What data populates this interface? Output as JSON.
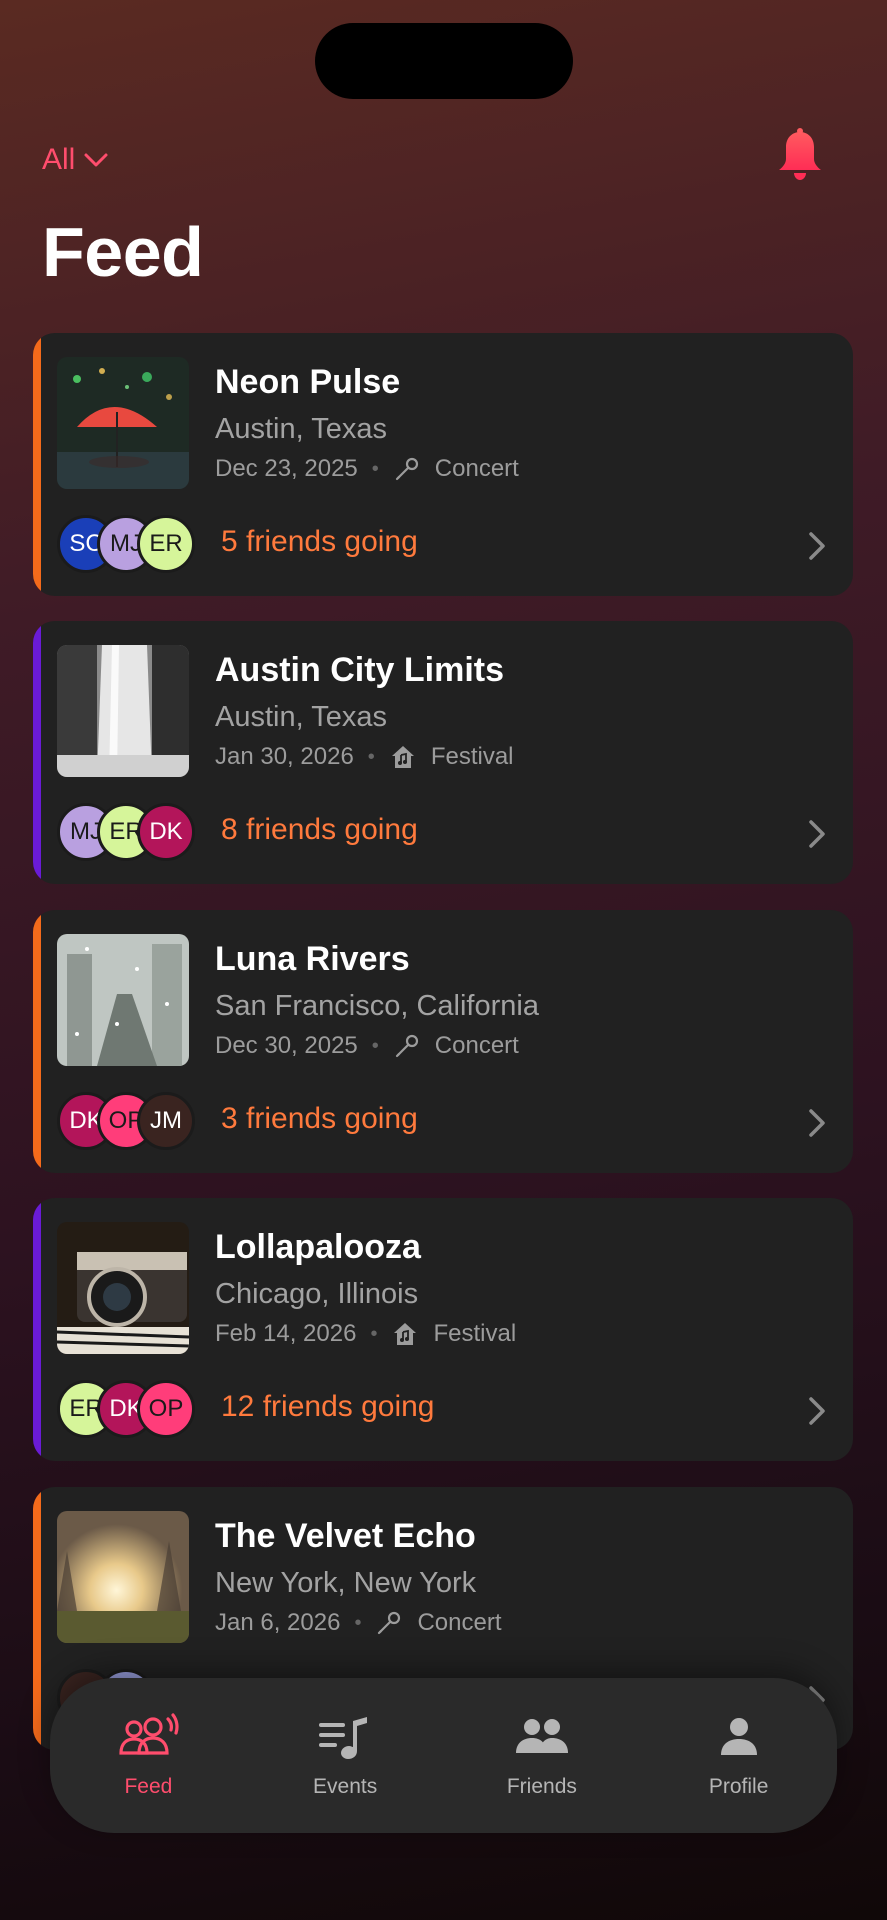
{
  "header": {
    "filter_label": "All",
    "title": "Feed"
  },
  "colors": {
    "accent_pink": "#ff4d6d",
    "accent_orange": "#ff7a3d",
    "concert_accent": "#f46a1b",
    "festival_accent": "#6a1bd6"
  },
  "events": [
    {
      "title": "Neon Pulse",
      "location": "Austin, Texas",
      "date": "Dec 23, 2025",
      "type": "Concert",
      "type_icon": "microphone-icon",
      "friends_text": "5 friends going",
      "avatars": [
        {
          "initials": "SC",
          "color": "#1a3fb8",
          "text_color": "#ffffff"
        },
        {
          "initials": "MJ",
          "color": "#b9a0e0",
          "text_color": "#1a1a1a"
        },
        {
          "initials": "ER",
          "color": "#d6f59a",
          "text_color": "#1a1a1a"
        }
      ],
      "image": "red-umbrella-night"
    },
    {
      "title": "Austin City Limits",
      "location": "Austin, Texas",
      "date": "Jan 30, 2026",
      "type": "Festival",
      "type_icon": "festival-house-icon",
      "friends_text": "8 friends going",
      "avatars": [
        {
          "initials": "MJ",
          "color": "#b9a0e0",
          "text_color": "#1a1a1a"
        },
        {
          "initials": "ER",
          "color": "#d6f59a",
          "text_color": "#1a1a1a"
        },
        {
          "initials": "DK",
          "color": "#b3155a",
          "text_color": "#ffffff"
        }
      ],
      "image": "waterfall-bw"
    },
    {
      "title": "Luna Rivers",
      "location": "San Francisco, California",
      "date": "Dec 30, 2025",
      "type": "Concert",
      "type_icon": "microphone-icon",
      "friends_text": "3 friends going",
      "avatars": [
        {
          "initials": "DK",
          "color": "#b3155a",
          "text_color": "#ffffff"
        },
        {
          "initials": "OP",
          "color": "#ff3d7a",
          "text_color": "#1a1a1a"
        },
        {
          "initials": "JM",
          "color": "#3a2420",
          "text_color": "#ffffff"
        }
      ],
      "image": "rainy-window-city"
    },
    {
      "title": "Lollapalooza",
      "location": "Chicago, Illinois",
      "date": "Feb 14, 2026",
      "type": "Festival",
      "type_icon": "festival-house-icon",
      "friends_text": "12 friends going",
      "avatars": [
        {
          "initials": "ER",
          "color": "#d6f59a",
          "text_color": "#1a1a1a"
        },
        {
          "initials": "DK",
          "color": "#b3155a",
          "text_color": "#ffffff"
        },
        {
          "initials": "OP",
          "color": "#ff3d7a",
          "text_color": "#1a1a1a"
        }
      ],
      "image": "vintage-camera"
    },
    {
      "title": "The Velvet Echo",
      "location": "New York, New York",
      "date": "Jan 6, 2026",
      "type": "Concert",
      "type_icon": "microphone-icon",
      "friends_text": "",
      "avatars": [
        {
          "initials": "",
          "color": "#3a2420",
          "text_color": "#ffffff"
        },
        {
          "initials": "",
          "color": "#9aa0e0",
          "text_color": "#1a1a1a"
        }
      ],
      "image": "sunset-field"
    }
  ],
  "tabbar": {
    "tabs": [
      {
        "label": "Feed",
        "icon": "feed-people-icon",
        "active": true
      },
      {
        "label": "Events",
        "icon": "music-list-icon",
        "active": false
      },
      {
        "label": "Friends",
        "icon": "friends-icon",
        "active": false
      },
      {
        "label": "Profile",
        "icon": "person-icon",
        "active": false
      }
    ]
  }
}
